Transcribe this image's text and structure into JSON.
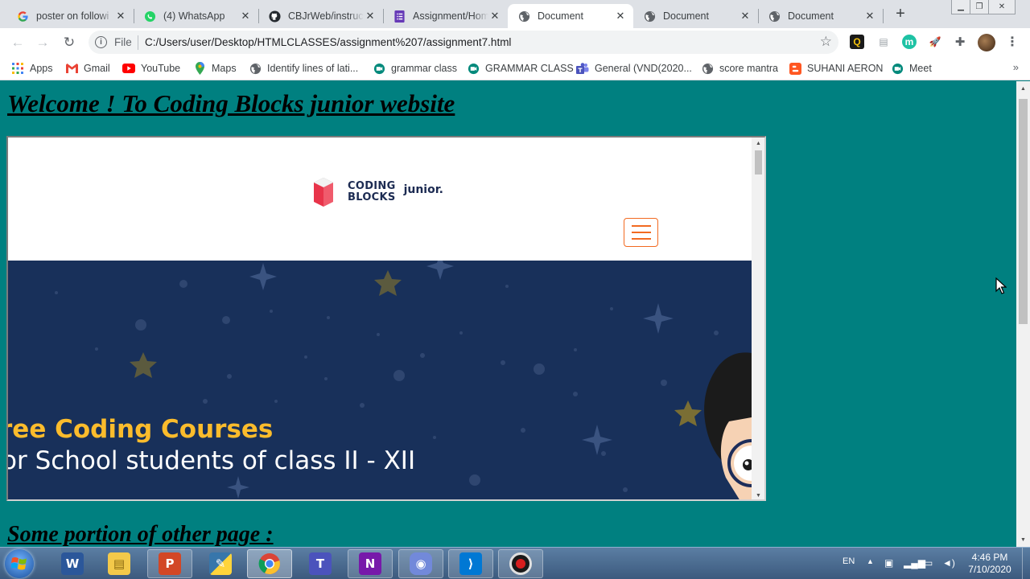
{
  "tabs": [
    {
      "title": "poster on followi",
      "icon": "google-g-icon",
      "active": false
    },
    {
      "title": "(4) WhatsApp",
      "icon": "whatsapp-icon",
      "active": false
    },
    {
      "title": "CBJrWeb/instruct",
      "icon": "github-icon",
      "active": false
    },
    {
      "title": "Assignment/Hom",
      "icon": "google-forms-icon",
      "active": false
    },
    {
      "title": "Document",
      "icon": "globe-icon",
      "active": true
    },
    {
      "title": "Document",
      "icon": "globe-icon",
      "active": false
    },
    {
      "title": "Document",
      "icon": "globe-icon",
      "active": false
    }
  ],
  "address_bar": {
    "scheme": "File",
    "url": "C:/Users/user/Desktop/HTMLCLASSES/assignment%207/assignment7.html"
  },
  "bookmarks": [
    {
      "label": "Apps",
      "icon": "apps-grid-icon"
    },
    {
      "label": "Gmail",
      "icon": "gmail-icon"
    },
    {
      "label": "YouTube",
      "icon": "youtube-icon"
    },
    {
      "label": "Maps",
      "icon": "maps-pin-icon"
    },
    {
      "label": "Identify lines of lati...",
      "icon": "globe-icon"
    },
    {
      "label": "grammar class",
      "icon": "meet-icon"
    },
    {
      "label": "GRAMMAR CLASS",
      "icon": "meet-icon"
    },
    {
      "label": "General (VND(2020...",
      "icon": "teams-icon"
    },
    {
      "label": "score mantra",
      "icon": "globe-icon"
    },
    {
      "label": "SUHANI AERON",
      "icon": "blogger-icon"
    },
    {
      "label": "Meet",
      "icon": "meet-icon"
    }
  ],
  "page": {
    "heading": "Welcome ! To Coding Blocks junior website",
    "subheading": "Some portion of other page :"
  },
  "embedded_site": {
    "logo_line1": "CODING",
    "logo_line2": "BLOCKS",
    "logo_junior": "junior.",
    "hero_line1": "ree Coding Courses",
    "hero_line2": "or School students of class II - XII"
  },
  "taskbar": {
    "apps": [
      "word-icon",
      "file-explorer-icon",
      "powerpoint-icon",
      "python-idle-icon",
      "chrome-icon",
      "teams-icon",
      "onenote-icon",
      "discord-icon",
      "vscode-icon",
      "obs-icon"
    ],
    "language": "EN",
    "time": "4:46 PM",
    "date": "7/10/2020"
  },
  "colors": {
    "page_background": "#008080",
    "hero_background": "#18305a",
    "hero_accent": "#fbbc2c",
    "menu_accent": "#f26a21"
  }
}
